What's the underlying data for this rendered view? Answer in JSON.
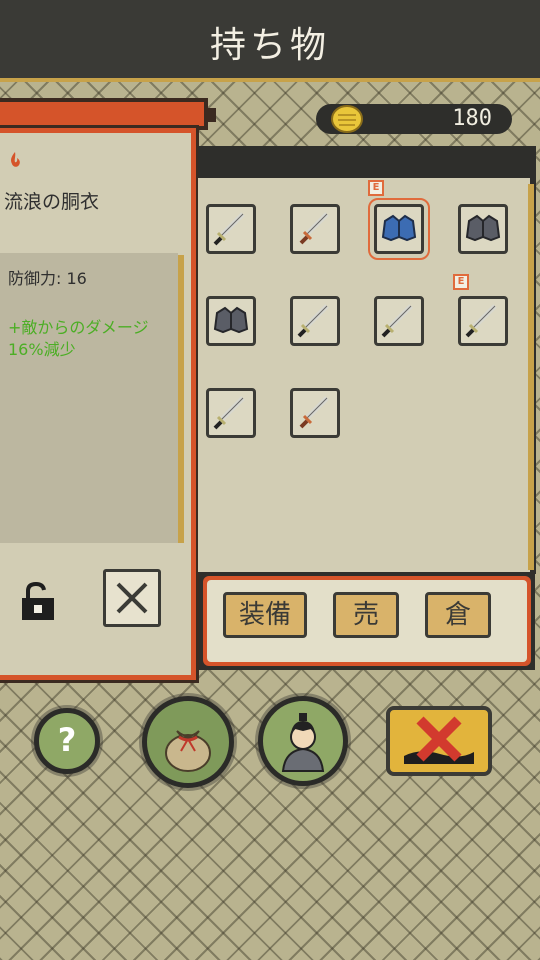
{
  "header": {
    "title": "持ち物"
  },
  "currency": {
    "amount": "180",
    "icon": "gold-coin-icon"
  },
  "detail": {
    "item_name": "流浪の胴衣",
    "stat_defense": "防御力: 16",
    "stat_bonus": "+敵からのダメージ16%減少"
  },
  "inventory": {
    "equipped_badge": "E",
    "slots": [
      {
        "icon": "sword-icon",
        "equipped": false
      },
      {
        "icon": "dagger-red-hilt-icon",
        "equipped": false
      },
      {
        "icon": "blue-robe-icon",
        "equipped": true,
        "selected": true
      },
      {
        "icon": "gray-robe-icon",
        "equipped": false
      },
      {
        "icon": "gray-robe-icon",
        "equipped": false
      },
      {
        "icon": "sword-icon",
        "equipped": false
      },
      {
        "icon": "sword-icon",
        "equipped": false
      },
      {
        "icon": "sword-icon",
        "equipped": true
      },
      {
        "icon": "sword-icon",
        "equipped": false
      },
      {
        "icon": "dagger-red-hilt-icon",
        "equipped": false
      }
    ]
  },
  "actions": {
    "equip": "装備",
    "sell": "売",
    "storage": "倉"
  },
  "bottom_nav": {
    "help": "?"
  },
  "colors": {
    "accent": "#d5542a",
    "gold": "#c7a24a",
    "dark": "#2e2e2b",
    "panel": "#d2cdb4",
    "bonus_text": "#4cae25"
  }
}
